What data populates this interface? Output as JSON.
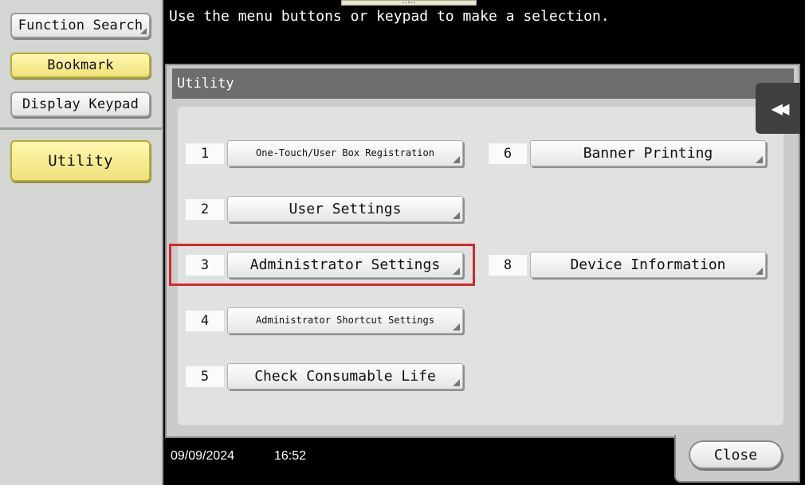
{
  "sidebar": {
    "function_search": "Function Search",
    "bookmark": "Bookmark",
    "display_keypad": "Display Keypad",
    "utility": "Utility"
  },
  "instruction": "Use the menu buttons or keypad to make a selection.",
  "panel": {
    "title": "Utility",
    "items": [
      {
        "num": "1",
        "label": "One-Touch/User Box Registration"
      },
      {
        "num": "2",
        "label": "User Settings"
      },
      {
        "num": "3",
        "label": "Administrator Settings"
      },
      {
        "num": "4",
        "label": "Administrator Shortcut Settings"
      },
      {
        "num": "5",
        "label": "Check Consumable Life"
      },
      {
        "num": "6",
        "label": "Banner Printing"
      },
      {
        "num": "8",
        "label": "Device Information"
      }
    ]
  },
  "status": {
    "date": "09/09/2024",
    "time": "16:52"
  },
  "close_label": "Close",
  "colors": {
    "highlight": "#d6262e",
    "selected": "#efe27a"
  }
}
